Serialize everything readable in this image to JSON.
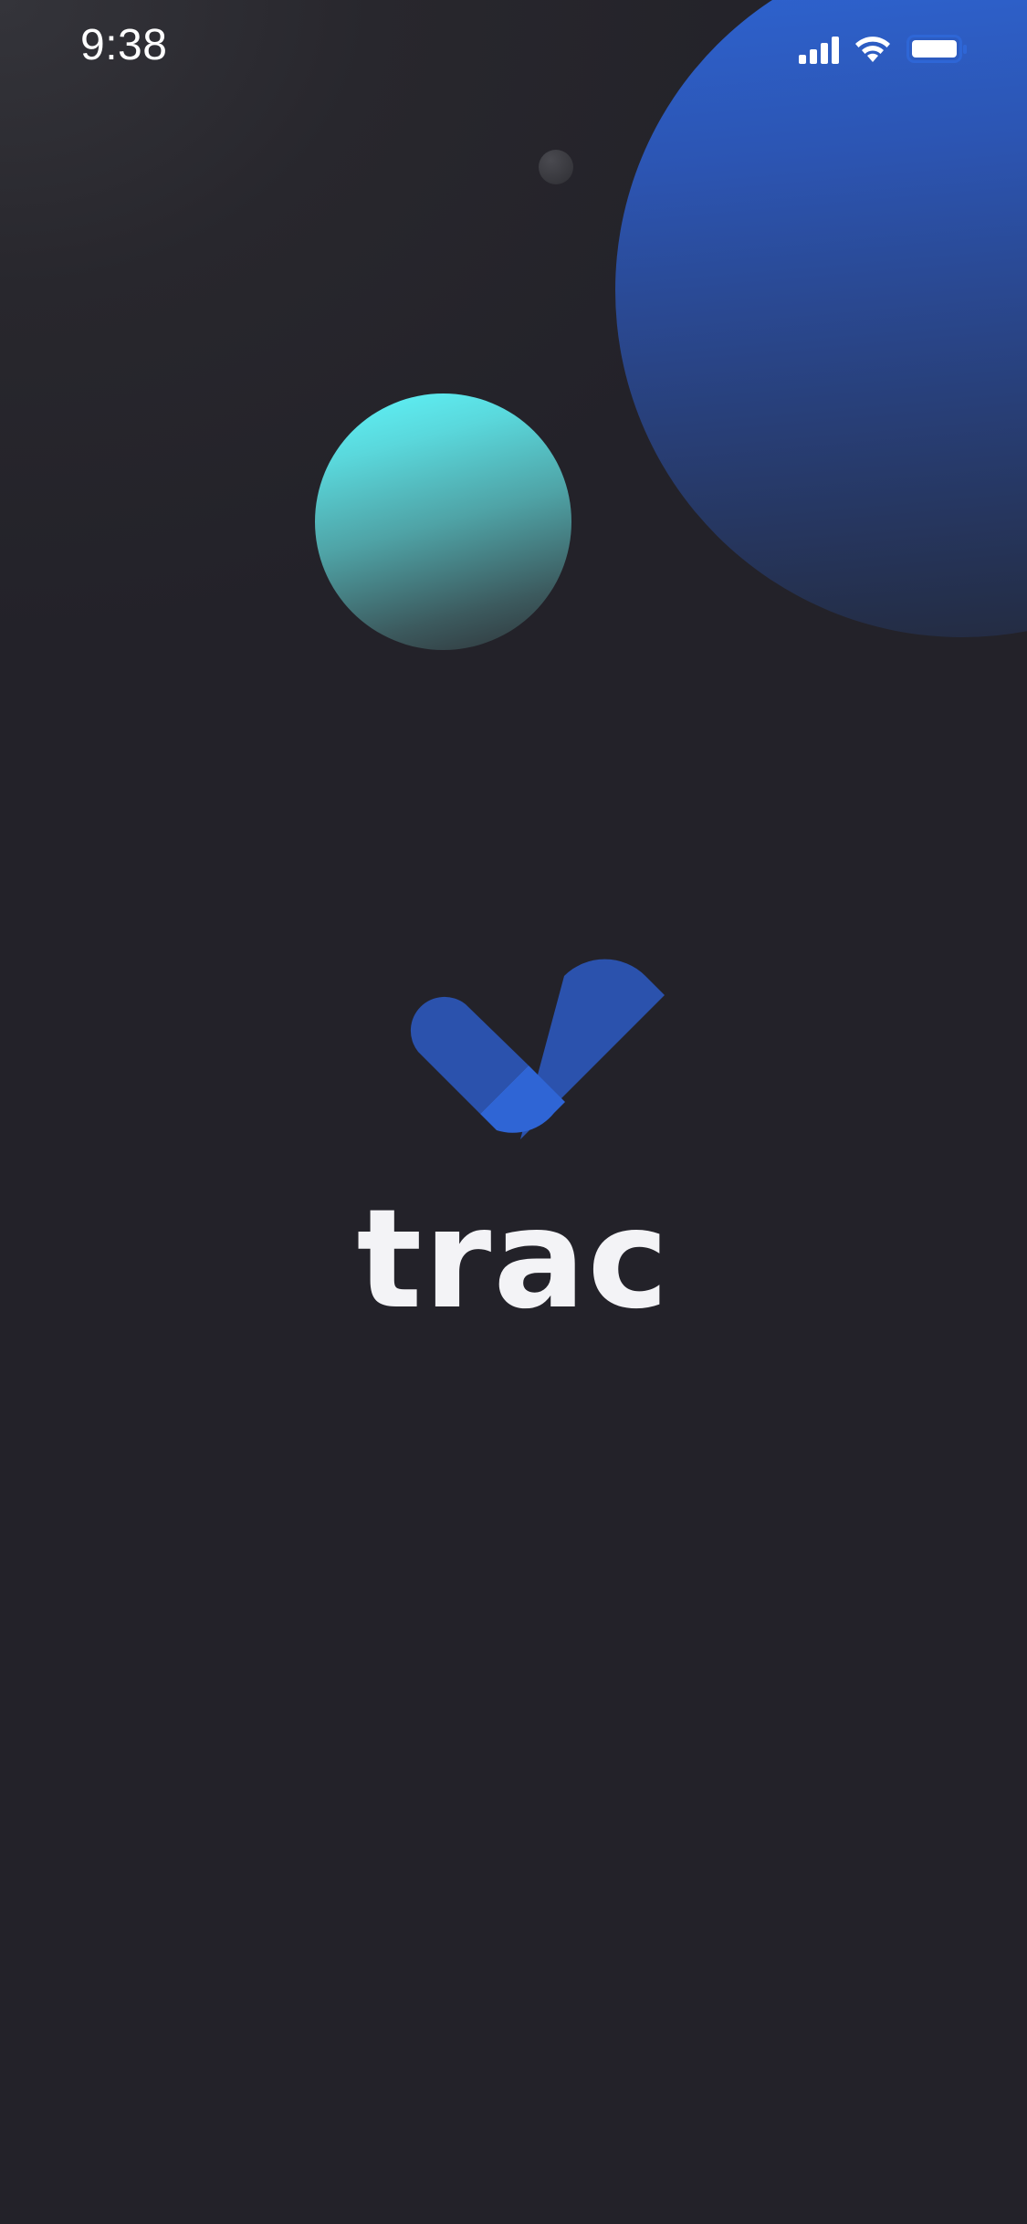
{
  "status_bar": {
    "time": "9:38",
    "signal_icon": "cellular-signal-icon",
    "wifi_icon": "wifi-icon",
    "battery_icon": "battery-icon"
  },
  "splash": {
    "brand_name": "trac",
    "logo_icon": "checkmark-logo-icon"
  },
  "colors": {
    "background": "#232229",
    "brand_blue": "#2e66d6",
    "accent_cyan": "#5ff6fb",
    "text": "#f3f3f6"
  }
}
